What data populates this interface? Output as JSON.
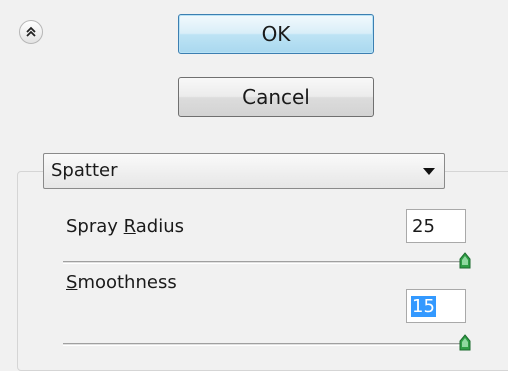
{
  "toolbar": {
    "collapse_icon": "double-chevron-up-icon",
    "ok_label": "OK",
    "cancel_label": "Cancel"
  },
  "filter": {
    "selected": "Spatter"
  },
  "controls": {
    "spray_radius": {
      "label_pre": "Spray ",
      "label_mnemonic": "R",
      "label_post": "adius",
      "value": "25",
      "slider_fraction": 1.0
    },
    "smoothness": {
      "label_pre": "",
      "label_mnemonic": "S",
      "label_post": "moothness",
      "value": "15",
      "slider_fraction": 1.0
    }
  },
  "colors": {
    "ok_border": "#3c7fb1",
    "selection": "#3399ff",
    "thumb": "#2e9e45"
  }
}
